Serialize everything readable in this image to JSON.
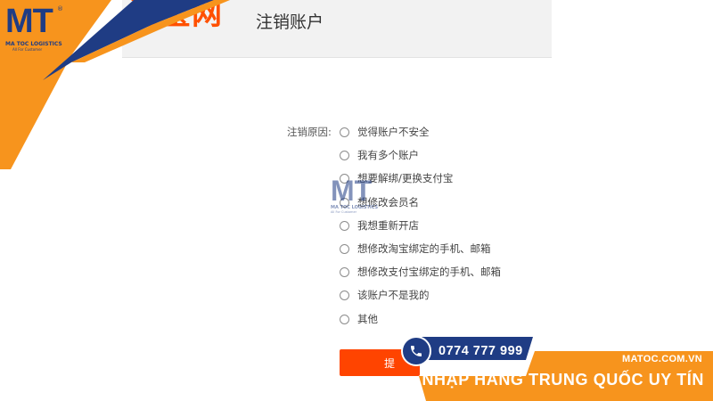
{
  "header": {
    "logo_text": "淘宝网",
    "title": "注销账户"
  },
  "form": {
    "reason_label": "注销原因:",
    "options": [
      "觉得账户不安全",
      "我有多个账户",
      "想要解绑/更换支付宝",
      "想修改会员名",
      "我想重新开店",
      "想修改淘宝绑定的手机、邮箱",
      "想修改支付宝绑定的手机、邮箱",
      "该账户不是我的",
      "其他"
    ],
    "submit_label": "提"
  },
  "watermark": {
    "logo": "MT",
    "name": "MA TOC LOGISTICS",
    "tagline": "All For Customer"
  },
  "brand": {
    "logo": "MT",
    "registered": "®",
    "name": "MA TOC LOGISTICS",
    "tagline": "All For Customer",
    "phone": "0774 777 999",
    "website": "MATOC.COM.VN",
    "slogan": "NHẬP HÀNG TRUNG QUỐC UY TÍN"
  },
  "colors": {
    "orange": "#f7941d",
    "navy": "#1f3c84",
    "taobao_orange": "#ff5000",
    "submit": "#ff4400"
  }
}
